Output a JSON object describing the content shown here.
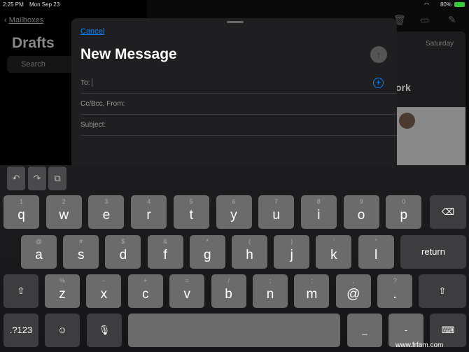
{
  "status_bar": {
    "time": "2:25 PM",
    "date": "Mon Sep 23",
    "battery": "80%"
  },
  "background": {
    "back_label": "Mailboxes",
    "title": "Drafts",
    "search_placeholder": "Search",
    "date_label": "Saturday",
    "partial_text": "ork"
  },
  "compose": {
    "cancel_label": "Cancel",
    "title": "New Message",
    "to_label": "To:",
    "cc_label": "Cc/Bcc, From:",
    "subject_label": "Subject:",
    "accent": "#0a84ff"
  },
  "keyboard": {
    "row1": [
      {
        "k": "q",
        "a": "1"
      },
      {
        "k": "w",
        "a": "2"
      },
      {
        "k": "e",
        "a": "3"
      },
      {
        "k": "r",
        "a": "4"
      },
      {
        "k": "t",
        "a": "5"
      },
      {
        "k": "y",
        "a": "6"
      },
      {
        "k": "u",
        "a": "7"
      },
      {
        "k": "i",
        "a": "8"
      },
      {
        "k": "o",
        "a": "9"
      },
      {
        "k": "p",
        "a": "0"
      }
    ],
    "row2": [
      {
        "k": "a",
        "a": "@"
      },
      {
        "k": "s",
        "a": "#"
      },
      {
        "k": "d",
        "a": "$"
      },
      {
        "k": "f",
        "a": "&"
      },
      {
        "k": "g",
        "a": "*"
      },
      {
        "k": "h",
        "a": "("
      },
      {
        "k": "j",
        "a": ")"
      },
      {
        "k": "k",
        "a": "'"
      },
      {
        "k": "l",
        "a": "\""
      }
    ],
    "row3": [
      {
        "k": "z",
        "a": "%"
      },
      {
        "k": "x",
        "a": "-"
      },
      {
        "k": "c",
        "a": "+"
      },
      {
        "k": "v",
        "a": "="
      },
      {
        "k": "b",
        "a": "/"
      },
      {
        "k": "n",
        "a": ";"
      },
      {
        "k": "m",
        "a": ":"
      },
      {
        "k": "@",
        "a": ","
      },
      {
        "k": ".",
        "a": "?"
      }
    ],
    "return_label": "return",
    "numbers_label": ".?123",
    "underscore": "_",
    "dash": "-"
  },
  "watermark": "www.frfam.com"
}
